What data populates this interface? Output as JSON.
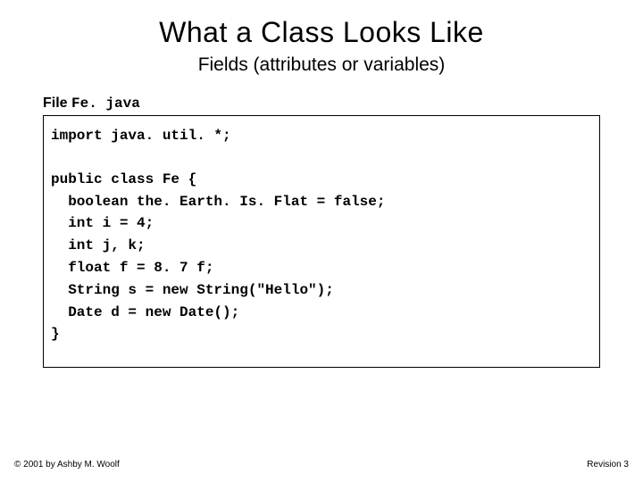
{
  "title": "What a Class Looks Like",
  "subtitle": "Fields (attributes or variables)",
  "file_label_prefix": "File ",
  "file_name": "Fe. java",
  "code": {
    "l1": "import java. util. *;",
    "l2": "public class Fe {",
    "l3": "  boolean the. Earth. Is. Flat = false;",
    "l4": "  int i = 4;",
    "l5": "  int j, k;",
    "l6": "  float f = 8. 7 f;",
    "l7": "  String s = new String(\"Hello\");",
    "l8": "  Date d = new Date();",
    "l9": "}"
  },
  "footer_left": "© 2001 by Ashby M. Woolf",
  "footer_right": "Revision 3"
}
